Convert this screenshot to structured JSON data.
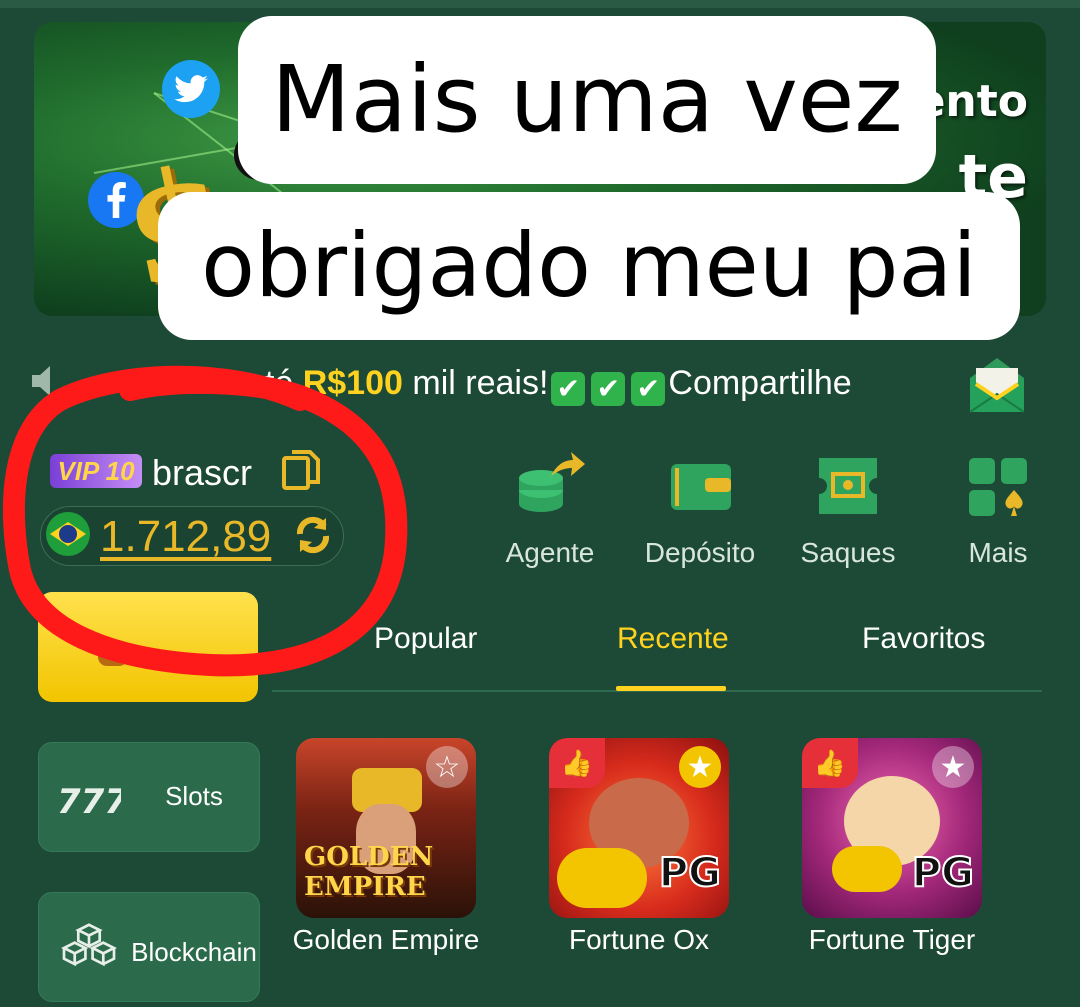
{
  "banner": {
    "text_line1": "ento",
    "text_line2": "te"
  },
  "caption": {
    "line1": "Mais uma vez",
    "line2": "obrigado meu pai"
  },
  "marquee": {
    "prefix": "até ",
    "highlight": "R$100",
    "suffix": " mil reais!",
    "check": "✔",
    "tail": "Compartilhe"
  },
  "account": {
    "vip_label": "VIP 10",
    "username": "brascr",
    "balance": "1.712,89"
  },
  "actions": [
    {
      "label": "Agente"
    },
    {
      "label": "Depósito"
    },
    {
      "label": "Saques"
    },
    {
      "label": "Mais"
    }
  ],
  "categories": [
    {
      "label": "Slots"
    },
    {
      "label": "Blockchain"
    }
  ],
  "tabs": [
    {
      "label": "Popular"
    },
    {
      "label": "Recente"
    },
    {
      "label": "Favoritos"
    }
  ],
  "active_tab": "Recente",
  "games": [
    {
      "name": "Golden Empire",
      "logo_text": "GOLDEN EMPIRE"
    },
    {
      "name": "Fortune Ox",
      "provider": "PG"
    },
    {
      "name": "Fortune Tiger",
      "provider": "PG"
    }
  ],
  "colors": {
    "background": "#1d4a36",
    "accent_yellow": "#ffd21f",
    "balance_gold": "#e9b829",
    "annotation_red": "#ff1a1a"
  }
}
